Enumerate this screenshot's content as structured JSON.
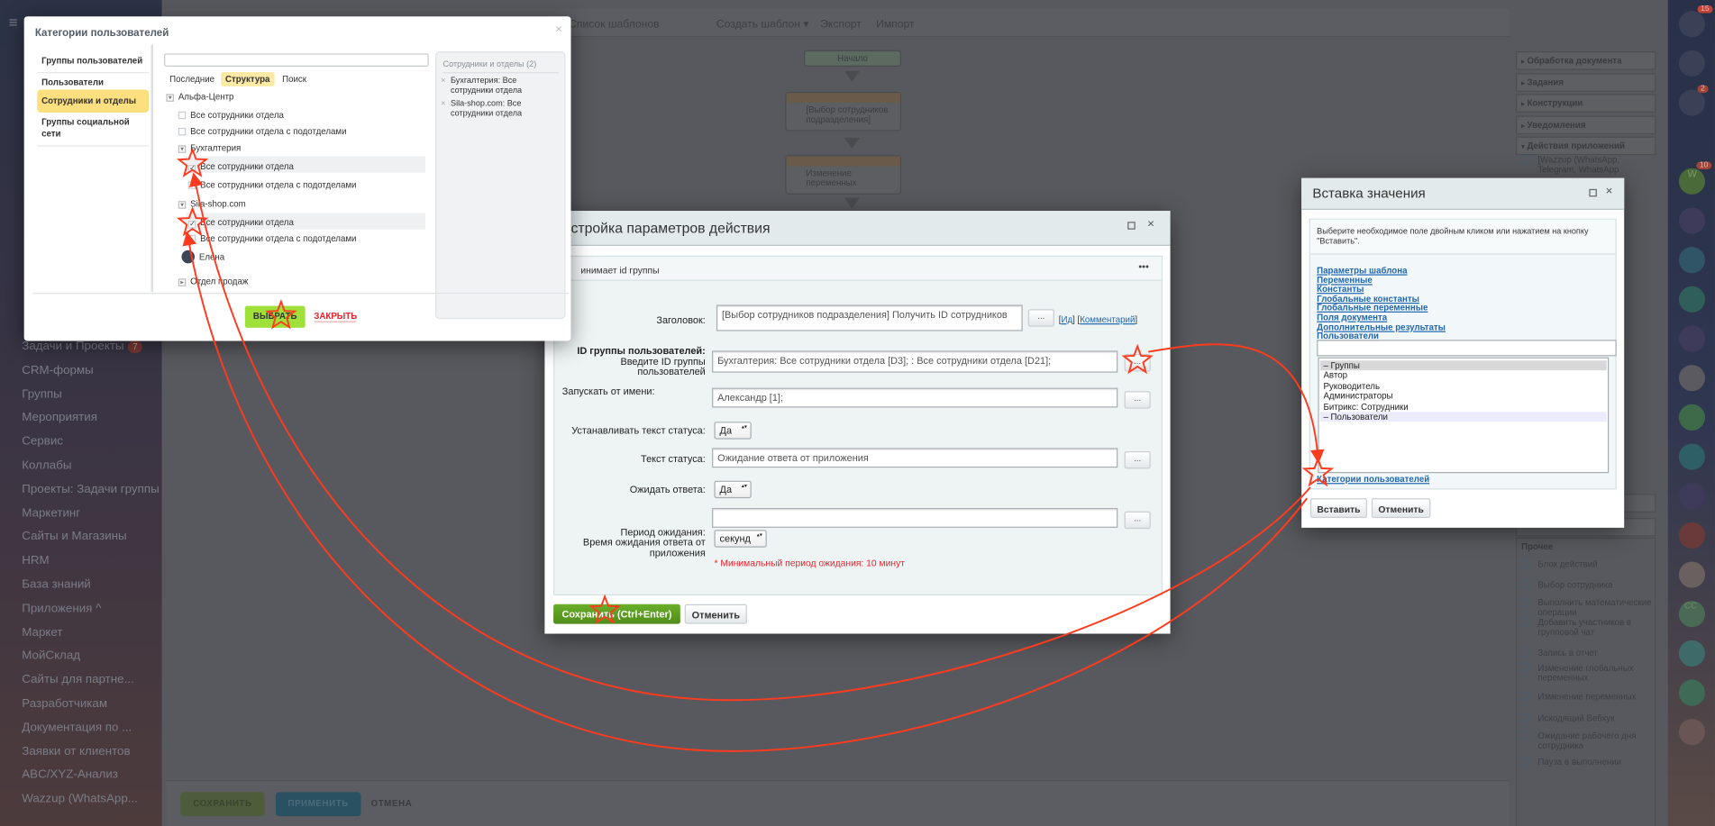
{
  "sidebar": {
    "menu_icon": "hamburger-icon",
    "items": [
      {
        "label": "Задачи и Проекты",
        "badge": "7"
      },
      {
        "label": "CRM-формы"
      },
      {
        "label": "Группы"
      },
      {
        "label": "Мероприятия"
      },
      {
        "label": "Сервис"
      },
      {
        "label": "Коллабы"
      },
      {
        "label": "Проекты: Задачи группы"
      },
      {
        "label": "Маркетинг"
      },
      {
        "label": "Сайты и Магазины"
      },
      {
        "label": "HRM"
      },
      {
        "label": "База знаний"
      },
      {
        "label": "Приложения ^"
      },
      {
        "label": "Маркет"
      },
      {
        "label": "МойСклад"
      },
      {
        "label": "Сайты для партне..."
      },
      {
        "label": "Разработчикам"
      },
      {
        "label": "Документация по ..."
      },
      {
        "label": "Заявки от клиентов"
      },
      {
        "label": "ABC/XYZ-Анализ"
      },
      {
        "label": "Wazzup (WhatsApp..."
      }
    ]
  },
  "toolbar": {
    "items": [
      "Список шаблонов",
      "Создать шаблон ▾",
      "Экспорт",
      "Импорт"
    ]
  },
  "flow": {
    "start": "Начало",
    "nodes": [
      "[Выбор сотрудников подразделения]",
      "Изменение переменных"
    ]
  },
  "bottom_bar": {
    "save": "СОХРАНИТЬ",
    "apply": "ПРИМЕНИТЬ",
    "cancel": "ОТМЕНА"
  },
  "right_panel": {
    "sections": [
      "Обработка документа",
      "Задания",
      "Конструкции",
      "Уведомления",
      "Действия приложений"
    ],
    "app_action": "[Wazzup (WhatsApp, Telegram, WhatsApp",
    "other_title": "Прочее",
    "other_items": [
      "Блок действий",
      "Выбор сотрудника",
      "Выполнить математические операции",
      "Добавить участников в групповой чат",
      "Запись в отчет",
      "Изменение глобальных переменных",
      "Изменение переменных",
      "Исходящий Вебхук",
      "Ожидание рабочего дня сотрудника",
      "Пауза в выполнении"
    ]
  },
  "icon_bar": {
    "badges": {
      "top": "15",
      "bell": "2",
      "w": "10"
    },
    "w_label": "W",
    "cc_label": "CC"
  },
  "user_categories_dialog": {
    "title": "Категории пользователей",
    "close": "×",
    "nav": [
      "Группы пользователей",
      "Пользователи",
      "Сотрудники и отделы",
      "Группы социальной сети"
    ],
    "active_nav": "Сотрудники и отделы",
    "search_value": "",
    "tabs": [
      "Последние",
      "Структура",
      "Поиск"
    ],
    "active_tab": "Структура",
    "tree": {
      "root": "Альфа-Центр",
      "root_all": "Все сотрудники отдела",
      "root_all_sub": "Все сотрудники отдела с подотделами",
      "dept1": "Бухгалтерия",
      "dept1_all": "Все сотрудники отдела",
      "dept1_all_checked": true,
      "dept1_all_sub": "Все сотрудники отдела с подотделами",
      "dept2": "Sila-shop.com",
      "dept2_all": "Все сотрудники отдела",
      "dept2_all_checked": true,
      "dept2_all_sub": "Все сотрудники отдела с подотделами",
      "user": "Елена",
      "dept3": "Отдел продаж"
    },
    "selected_title": "Сотрудники и отделы (2)",
    "selected": [
      "Бухгалтерия: Все сотрудники отдела",
      "Sila-shop.com: Все сотрудники отдела"
    ],
    "select_button": "ВЫБРАТЬ",
    "close_button": "ЗАКРЫТЬ"
  },
  "action_dialog": {
    "title": "стройка параметров действия",
    "subtitle": "инимает id группы",
    "more": "•••",
    "fields": {
      "title_label": "Заголовок:",
      "title_value": "[Выбор сотрудников подразделения] Получить ID сотрудников",
      "id_link": "Ид",
      "comment_link": "Комментарий",
      "group_label": "ID группы пользователей:",
      "group_hint1": "Введите ID группы",
      "group_hint2": "пользователей",
      "group_value": "Бухгалтерия: Все сотрудники отдела [D3];                       : Все сотрудники отдела [D21];",
      "run_as_label": "Запускать от имени:",
      "run_as_value": "Александр              [1];",
      "set_status_label": "Устанавливать текст статуса:",
      "set_status_value": "Да",
      "status_text_label": "Текст статуса:",
      "status_text_value": "Ожидание ответа от приложения",
      "wait_label": "Ожидать ответа:",
      "wait_value": "Да",
      "period_value": "",
      "period_label1": "Период ожидания:",
      "period_label2": "Время ожидания ответа от",
      "period_label3": "приложения",
      "period_unit": "секунд",
      "min_note": "* Минимальный период ожидания: 10 минут"
    },
    "dots": "...",
    "save": "Сохранить (Ctrl+Enter)",
    "cancel": "Отменить"
  },
  "insert_dialog": {
    "title": "Вставка значения",
    "description": "Выберите необходимое поле двойным кликом или нажатием на кнопку \"Вставить\".",
    "links": [
      "Параметры шаблона",
      "Переменные",
      "Константы",
      "Глобальные константы",
      "Глобальные переменные",
      "Поля документа",
      "Дополнительные результаты",
      "Пользователи"
    ],
    "search_value": "",
    "list": [
      "– Группы",
      "Автор",
      "Руководитель",
      "Администраторы",
      "Битрикс: Сотрудники",
      "– Пользователи"
    ],
    "bottom_link": "Категории пользователей",
    "insert": "Вставить",
    "cancel": "Отменить"
  },
  "colors": {
    "annotation": "#ff3b1f",
    "save_green": "#5b9d1f",
    "select_green": "#9fe03a",
    "link": "#2067b0",
    "active_nav": "#fcdf7f",
    "warning": "#e8232b"
  }
}
